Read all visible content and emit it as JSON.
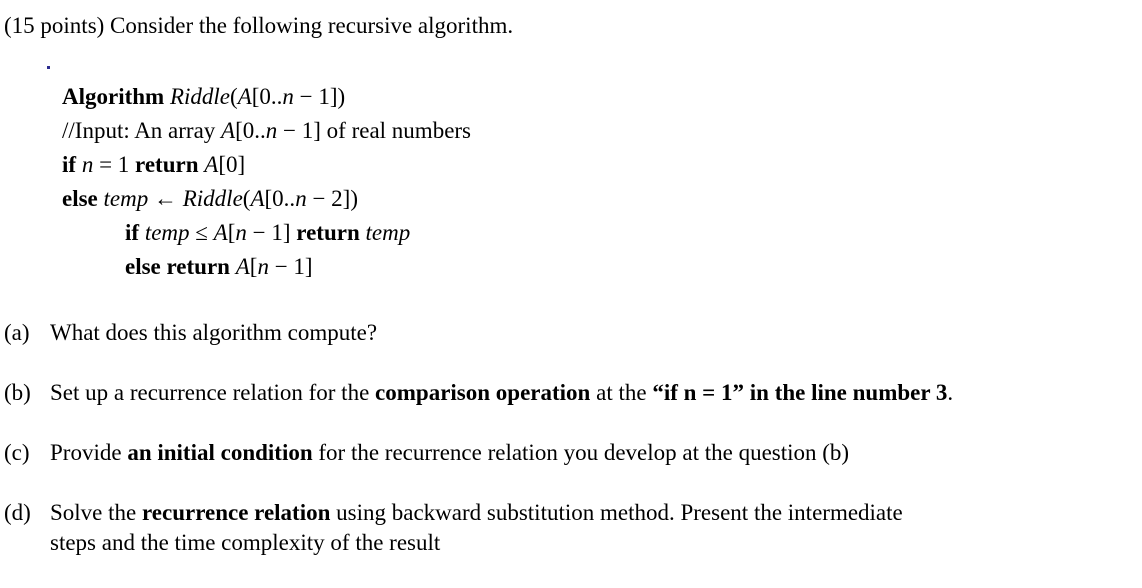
{
  "document": {
    "intro": "(15 points) Consider the following recursive algorithm.",
    "algorithm": {
      "lines": [
        {
          "id": "algorithm-header",
          "indent": false,
          "parts": [
            {
              "text": "Algorithm",
              "style": "bold"
            },
            {
              "text": " ",
              "style": "plain"
            },
            {
              "text": "Riddle",
              "style": "math-italic"
            },
            {
              "text": "(",
              "style": "math"
            },
            {
              "text": "A",
              "style": "math-italic"
            },
            {
              "text": "[0..",
              "style": "math"
            },
            {
              "text": "n",
              "style": "math-italic"
            },
            {
              "text": " − 1])",
              "style": "math"
            }
          ]
        },
        {
          "id": "input-comment",
          "indent": false,
          "parts": [
            {
              "text": "//Input:  An array ",
              "style": "plain"
            },
            {
              "text": "A",
              "style": "math-italic"
            },
            {
              "text": "[0..",
              "style": "math"
            },
            {
              "text": "n",
              "style": "math-italic"
            },
            {
              "text": " − 1]",
              "style": "math"
            },
            {
              "text": " of real numbers",
              "style": "plain"
            }
          ]
        },
        {
          "id": "if-base-case",
          "indent": false,
          "parts": [
            {
              "text": "if",
              "style": "bold"
            },
            {
              "text": " ",
              "style": "plain"
            },
            {
              "text": "n",
              "style": "math-italic"
            },
            {
              "text": " = 1 ",
              "style": "math"
            },
            {
              "text": "return",
              "style": "bold"
            },
            {
              "text": " ",
              "style": "plain"
            },
            {
              "text": "A",
              "style": "math-italic"
            },
            {
              "text": "[0]",
              "style": "math"
            }
          ]
        },
        {
          "id": "else-recursive-call",
          "indent": false,
          "parts": [
            {
              "text": "else",
              "style": "bold"
            },
            {
              "text": " ",
              "style": "plain"
            },
            {
              "text": "temp",
              "style": "math-italic"
            },
            {
              "text": " ← ",
              "style": "math"
            },
            {
              "text": "Riddle",
              "style": "math-italic"
            },
            {
              "text": "(",
              "style": "math"
            },
            {
              "text": "A",
              "style": "math-italic"
            },
            {
              "text": "[0..",
              "style": "math"
            },
            {
              "text": "n",
              "style": "math-italic"
            },
            {
              "text": " − 2])",
              "style": "math"
            }
          ]
        },
        {
          "id": "if-temp-compare",
          "indent": true,
          "parts": [
            {
              "text": "if",
              "style": "bold"
            },
            {
              "text": " ",
              "style": "plain"
            },
            {
              "text": "temp",
              "style": "math-italic"
            },
            {
              "text": " ≤ ",
              "style": "math"
            },
            {
              "text": "A",
              "style": "math-italic"
            },
            {
              "text": "[",
              "style": "math"
            },
            {
              "text": "n",
              "style": "math-italic"
            },
            {
              "text": " − 1] ",
              "style": "math"
            },
            {
              "text": "return",
              "style": "bold"
            },
            {
              "text": " ",
              "style": "plain"
            },
            {
              "text": "temp",
              "style": "math-italic"
            }
          ]
        },
        {
          "id": "else-return-last",
          "indent": true,
          "parts": [
            {
              "text": "else return",
              "style": "bold"
            },
            {
              "text": " ",
              "style": "plain"
            },
            {
              "text": "A",
              "style": "math-italic"
            },
            {
              "text": "[",
              "style": "math"
            },
            {
              "text": "n",
              "style": "math-italic"
            },
            {
              "text": " − 1]",
              "style": "math"
            }
          ]
        }
      ]
    },
    "questions": [
      {
        "id": "question-a",
        "label": "(a)",
        "parts": [
          {
            "text": "What does this algorithm compute?",
            "style": "plain"
          }
        ]
      },
      {
        "id": "question-b",
        "label": "(b)",
        "parts": [
          {
            "text": "Set up a recurrence relation for the ",
            "style": "plain"
          },
          {
            "text": "comparison operation",
            "style": "bold"
          },
          {
            "text": " at the ",
            "style": "plain"
          },
          {
            "text": "“if n = 1” in the line number 3",
            "style": "bold"
          },
          {
            "text": ".",
            "style": "plain"
          }
        ]
      },
      {
        "id": "question-c",
        "label": "(c)",
        "parts": [
          {
            "text": "Provide ",
            "style": "plain"
          },
          {
            "text": "an initial condition",
            "style": "bold"
          },
          {
            "text": " for the recurrence relation you develop at the question (b)",
            "style": "plain"
          }
        ]
      },
      {
        "id": "question-d",
        "label": "(d)",
        "parts": [
          {
            "text": "Solve the ",
            "style": "plain"
          },
          {
            "text": "recurrence relation",
            "style": "bold"
          },
          {
            "text": " using backward substitution method. Present the intermediate",
            "style": "plain"
          },
          {
            "text": "\n",
            "style": "break"
          },
          {
            "text": "steps and the time complexity of the result",
            "style": "plain"
          }
        ]
      }
    ]
  },
  "artifacts": {
    "stray_dot_color": "#2b2b8f"
  },
  "colors": {
    "background": "#ffffff",
    "text": "#000000"
  }
}
